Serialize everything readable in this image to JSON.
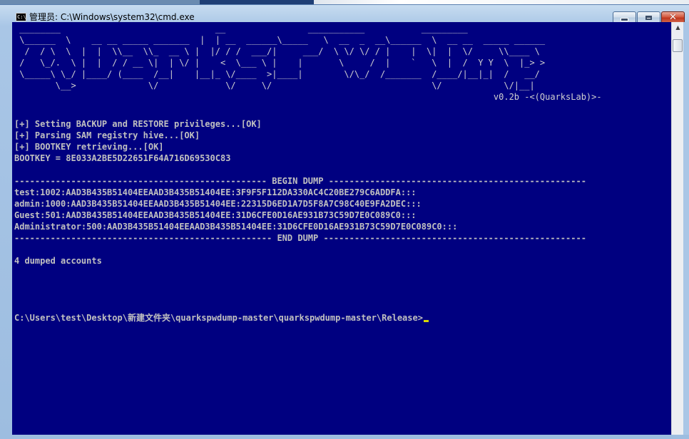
{
  "window": {
    "title": "管理员: C:\\Windows\\system32\\cmd.exe",
    "icon": "console-icon",
    "buttons": {
      "minimize": "minimize-icon",
      "maximize": "maximize-icon",
      "close": "✕"
    }
  },
  "console": {
    "banner": [
      " ________                              __                ___________           _________",
      " \\______  \\    __ __ _____ _______  |  | __  ______\\_____   \\  __  _  __\\______  \\  __ __  _____ ______",
      "  /  / \\  \\  |  |  \\\\__  \\\\_  __ \\ |  |/ / /  ___/|     ___/  \\ \\/ \\/ / |    |  \\|  |  \\/     \\\\____ \\",
      " /   \\_/.  \\ |  |  / / __ \\|  | \\/ |    <  \\___ \\ |    |       \\     /  |    `   \\  |  /  Y Y  \\  |_> >",
      " \\_____\\ \\_/ |____/ (____  /__|    |__|_ \\/____  >|____|        \\/\\_/  /_______  /____/|__|_|  /   __/",
      "        \\__>              \\/             \\/     \\/                               \\/            \\/|__|",
      "                                                                                             v0.2b -<(QuarksLab)>-"
    ],
    "status_lines": [
      "[+] Setting BACKUP and RESTORE privileges...[OK]",
      "[+] Parsing SAM registry hive...[OK]",
      "[+] BOOTKEY retrieving...[OK]",
      "BOOTKEY = 8E033A2BE5D22651F64A716D69530C83"
    ],
    "begin_dump": "------------------------------------------------- BEGIN DUMP --------------------------------------------------",
    "accounts": [
      "test:1002:AAD3B435B51404EEAAD3B435B51404EE:3F9F5F112DA330AC4C20BE279C6ADDFA:::",
      "admin:1000:AAD3B435B51404EEAAD3B435B51404EE:22315D6ED1A7D5F8A7C98C40E9FA2DEC:::",
      "Guest:501:AAD3B435B51404EEAAD3B435B51404EE:31D6CFE0D16AE931B73C59D7E0C089C0:::",
      "Administrator:500:AAD3B435B51404EEAAD3B435B51404EE:31D6CFE0D16AE931B73C59D7E0C089C0:::"
    ],
    "end_dump": "-------------------------------------------------- END DUMP ---------------------------------------------------",
    "summary": "4 dumped accounts",
    "prompt": "C:\\Users\\test\\Desktop\\新建文件夹\\quarkspwdump-master\\quarkspwdump-master\\Release>"
  },
  "colors": {
    "console_bg": "#000080",
    "console_fg": "#c0c0c0",
    "cursor": "#d8d800"
  }
}
